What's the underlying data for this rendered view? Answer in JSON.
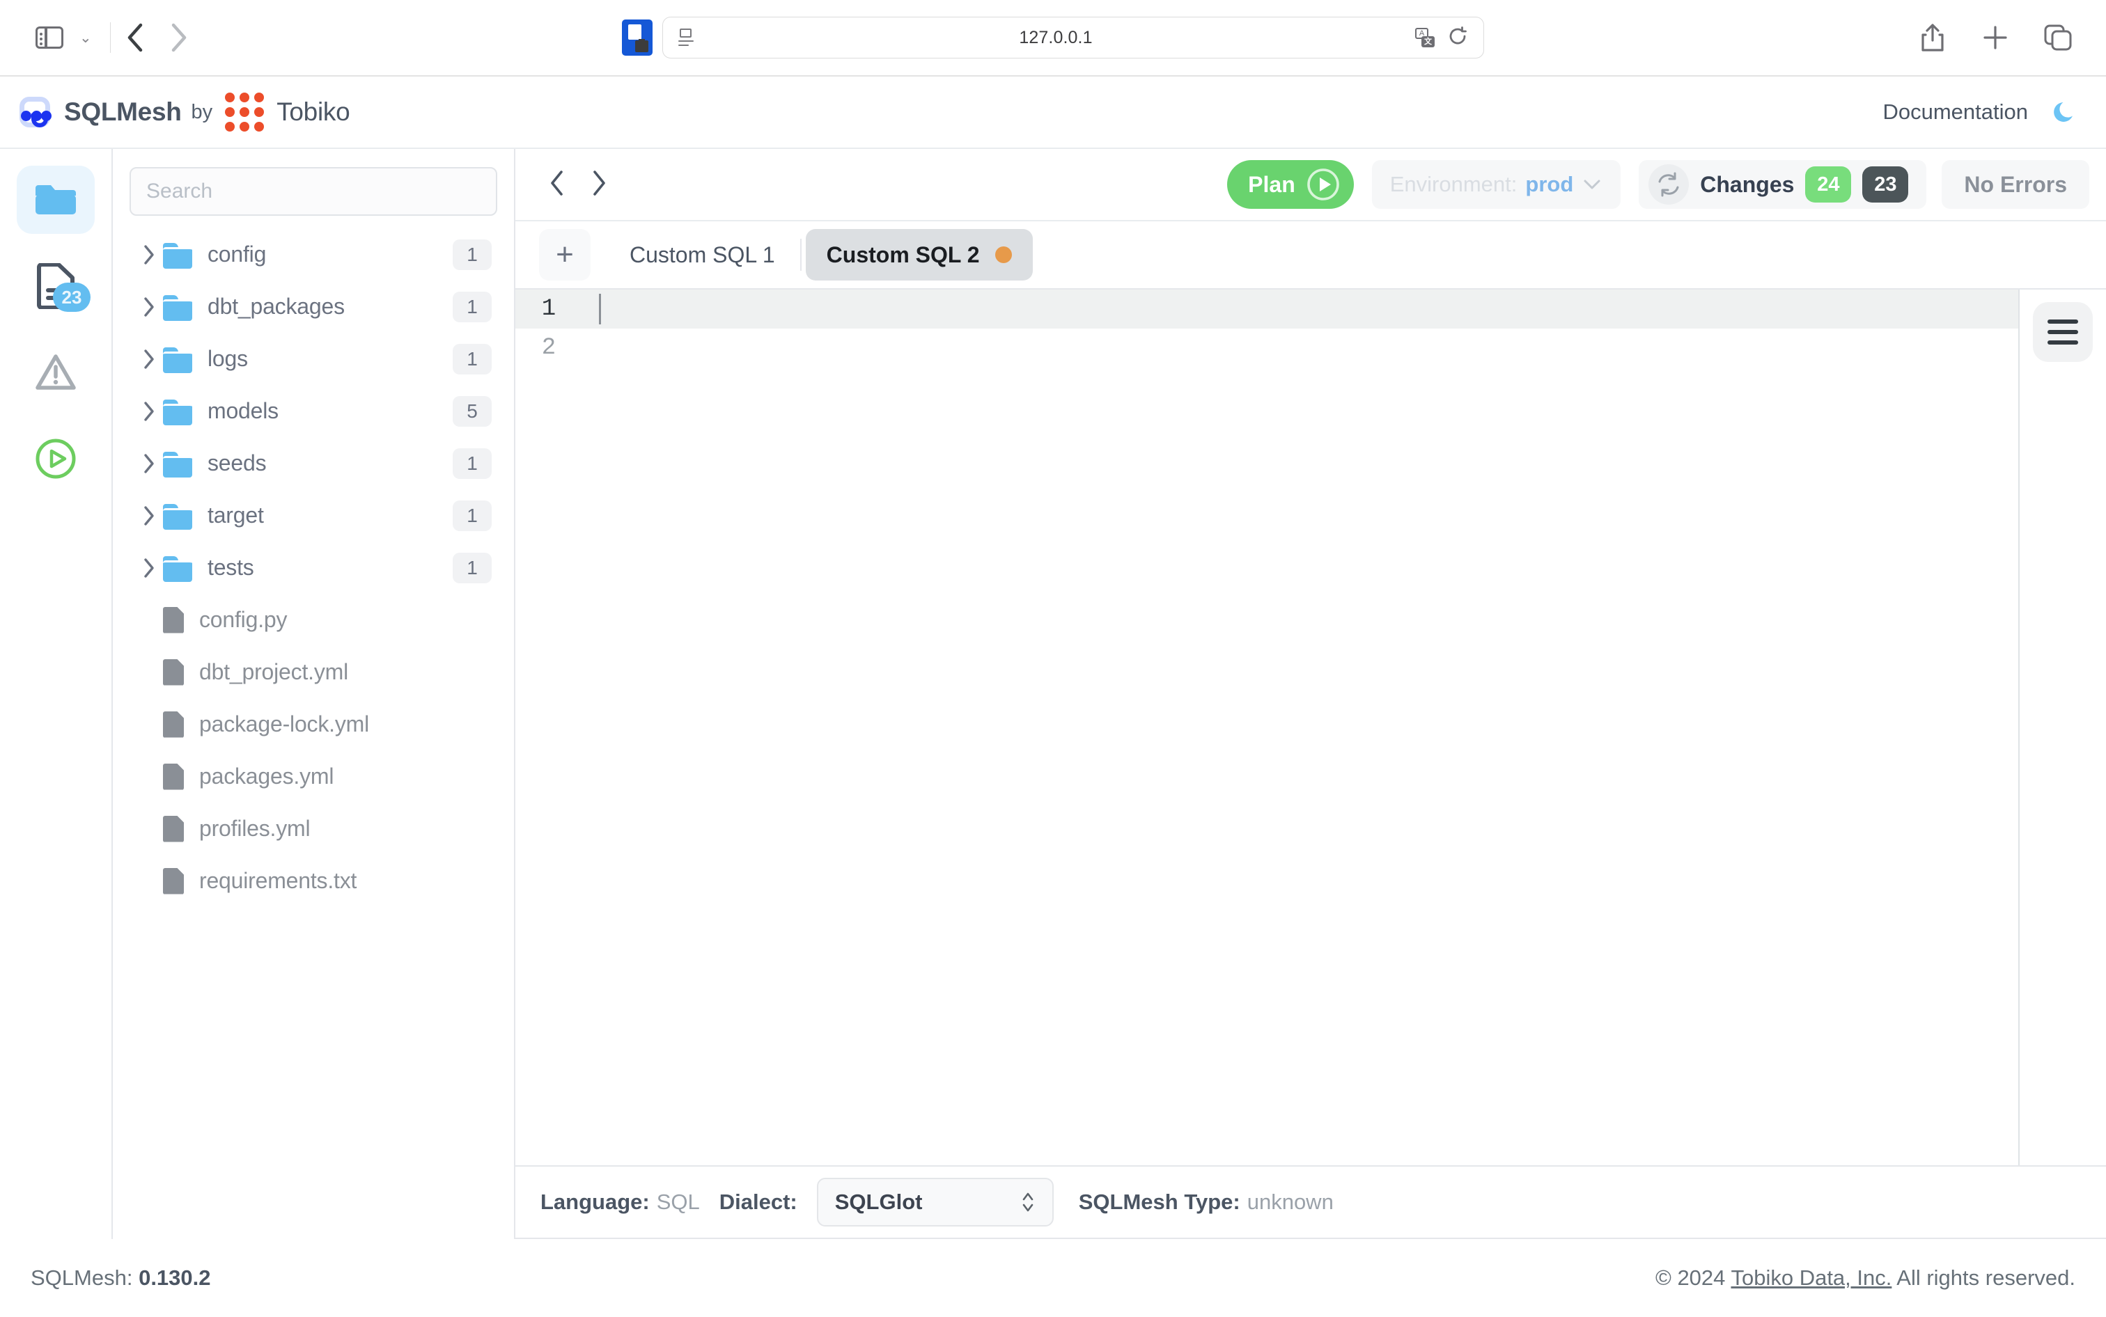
{
  "browser": {
    "url": "127.0.0.1",
    "icons": {
      "sidebar_toggle": "sidebar-toggle-icon",
      "sidebar_chevron": "chevron-down-icon",
      "back": "back-arrow-icon",
      "forward": "forward-arrow-icon",
      "shield": "extension-shield-icon",
      "reader": "reader-view-icon",
      "translate": "translate-icon",
      "reload": "reload-icon",
      "share": "share-icon",
      "new_tab": "plus-icon",
      "tabs_overview": "tabs-overview-icon"
    }
  },
  "header": {
    "brand_name": "SQLMesh",
    "brand_by": "by",
    "brand_tobiko": "Tobiko",
    "documentation": "Documentation",
    "theme_toggle": "moon-icon"
  },
  "toolbar": {
    "plan_label": "Plan",
    "environment_label": "Environment:",
    "environment_value": "prod",
    "changes_label": "Changes",
    "changes_added": "24",
    "changes_modified": "23",
    "errors_label": "No Errors"
  },
  "explorer": {
    "search_placeholder": "Search",
    "folders": [
      {
        "name": "config",
        "count": "1"
      },
      {
        "name": "dbt_packages",
        "count": "1"
      },
      {
        "name": "logs",
        "count": "1"
      },
      {
        "name": "models",
        "count": "5"
      },
      {
        "name": "seeds",
        "count": "1"
      },
      {
        "name": "target",
        "count": "1"
      },
      {
        "name": "tests",
        "count": "1"
      }
    ],
    "files": [
      {
        "name": "config.py"
      },
      {
        "name": "dbt_project.yml"
      },
      {
        "name": "package-lock.yml"
      },
      {
        "name": "packages.yml"
      },
      {
        "name": "profiles.yml"
      },
      {
        "name": "requirements.txt"
      }
    ]
  },
  "rail": {
    "items": [
      {
        "icon": "folder-icon",
        "badge": ""
      },
      {
        "icon": "document-icon",
        "badge": "23"
      },
      {
        "icon": "warning-triangle-icon",
        "badge": ""
      },
      {
        "icon": "play-circle-icon",
        "badge": ""
      }
    ]
  },
  "tabs": {
    "add_label": "+",
    "items": [
      {
        "label": "Custom SQL 1",
        "active": false,
        "dirty": false
      },
      {
        "label": "Custom SQL 2",
        "active": true,
        "dirty": true
      }
    ]
  },
  "editor": {
    "lines": [
      {
        "number": "1",
        "text": ""
      },
      {
        "number": "2",
        "text": ""
      }
    ]
  },
  "status": {
    "language_key": "Language:",
    "language_value": "SQL",
    "dialect_key": "Dialect:",
    "dialect_value": "SQLGlot",
    "type_key": "SQLMesh Type:",
    "type_value": "unknown"
  },
  "footer": {
    "version_key": "SQLMesh:",
    "version_value": "0.130.2",
    "copyright_prefix": "© 2024",
    "company_link": "Tobiko Data, Inc.",
    "rights": "All rights reserved."
  },
  "colors": {
    "accent_green": "#69d36e",
    "accent_blue": "#63bdf0",
    "orange_dot": "#e79a4a",
    "dark_badge": "#4c5559"
  }
}
